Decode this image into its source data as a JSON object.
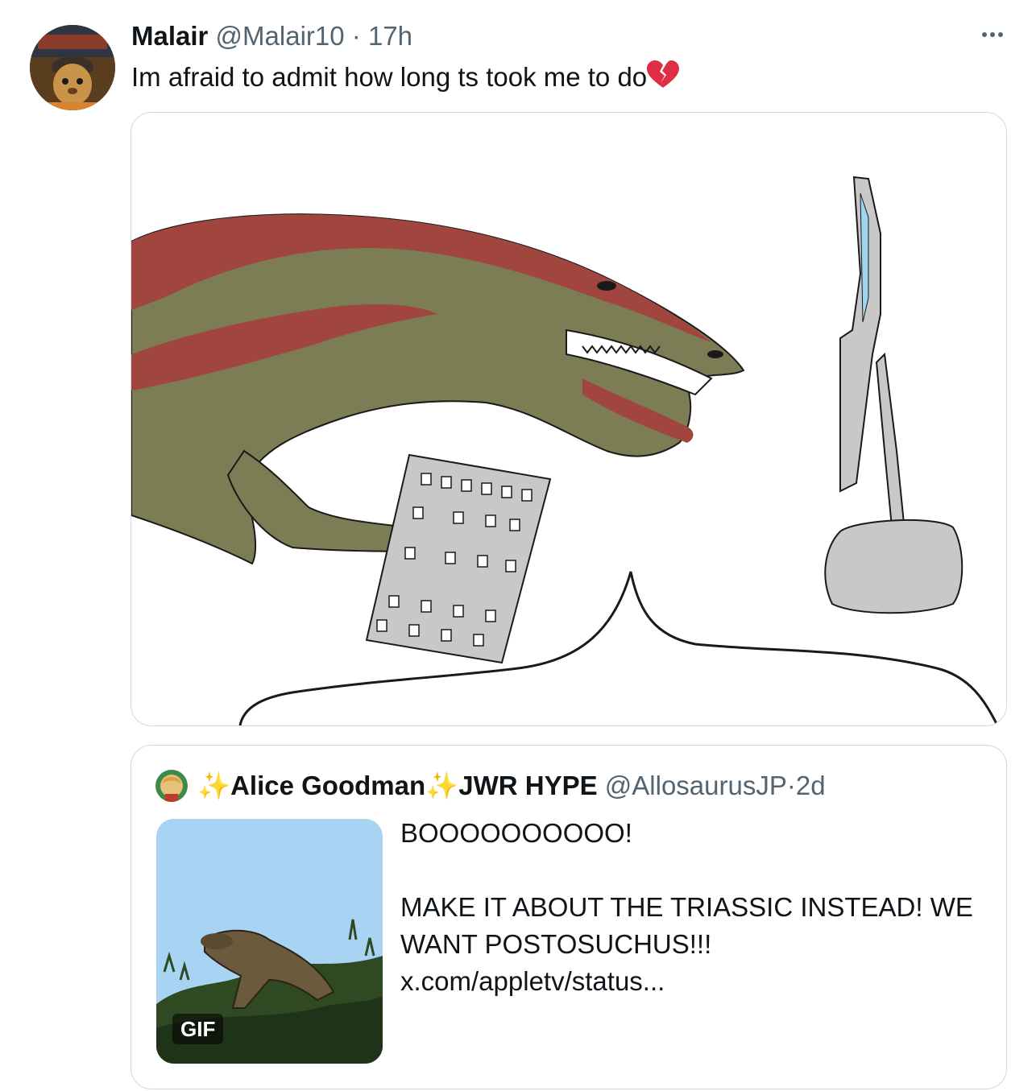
{
  "tweet": {
    "author_name": "Malair",
    "author_handle": "@Malair10",
    "separator": "·",
    "time": "17h",
    "text": "Im afraid to admit how long ts took me to do",
    "emoji_icon": "broken-heart-icon",
    "more_icon": "more-options-icon"
  },
  "quote": {
    "sparkle_left": "✨",
    "author_name": "Alice Goodman",
    "sparkle_right": "✨",
    "author_suffix": "JWR HYPE",
    "author_handle": "@AllosaurusJP",
    "separator": "·",
    "time": "2d",
    "text_line1": "BOOOOOOOOOO!",
    "text_line2": "MAKE IT ABOUT THE TRIASSIC INSTEAD! WE WANT POSTOSUCHUS!!! x.com/appletv/status...",
    "media_badge": "GIF"
  },
  "colors": {
    "text": "#0f1419",
    "muted": "#536471",
    "border": "#cfd9de",
    "dino_green": "#7d7d55",
    "dino_red": "#a0463f",
    "keyboard_gray": "#c8c8c8",
    "sky_blue": "#a9d3f2"
  }
}
